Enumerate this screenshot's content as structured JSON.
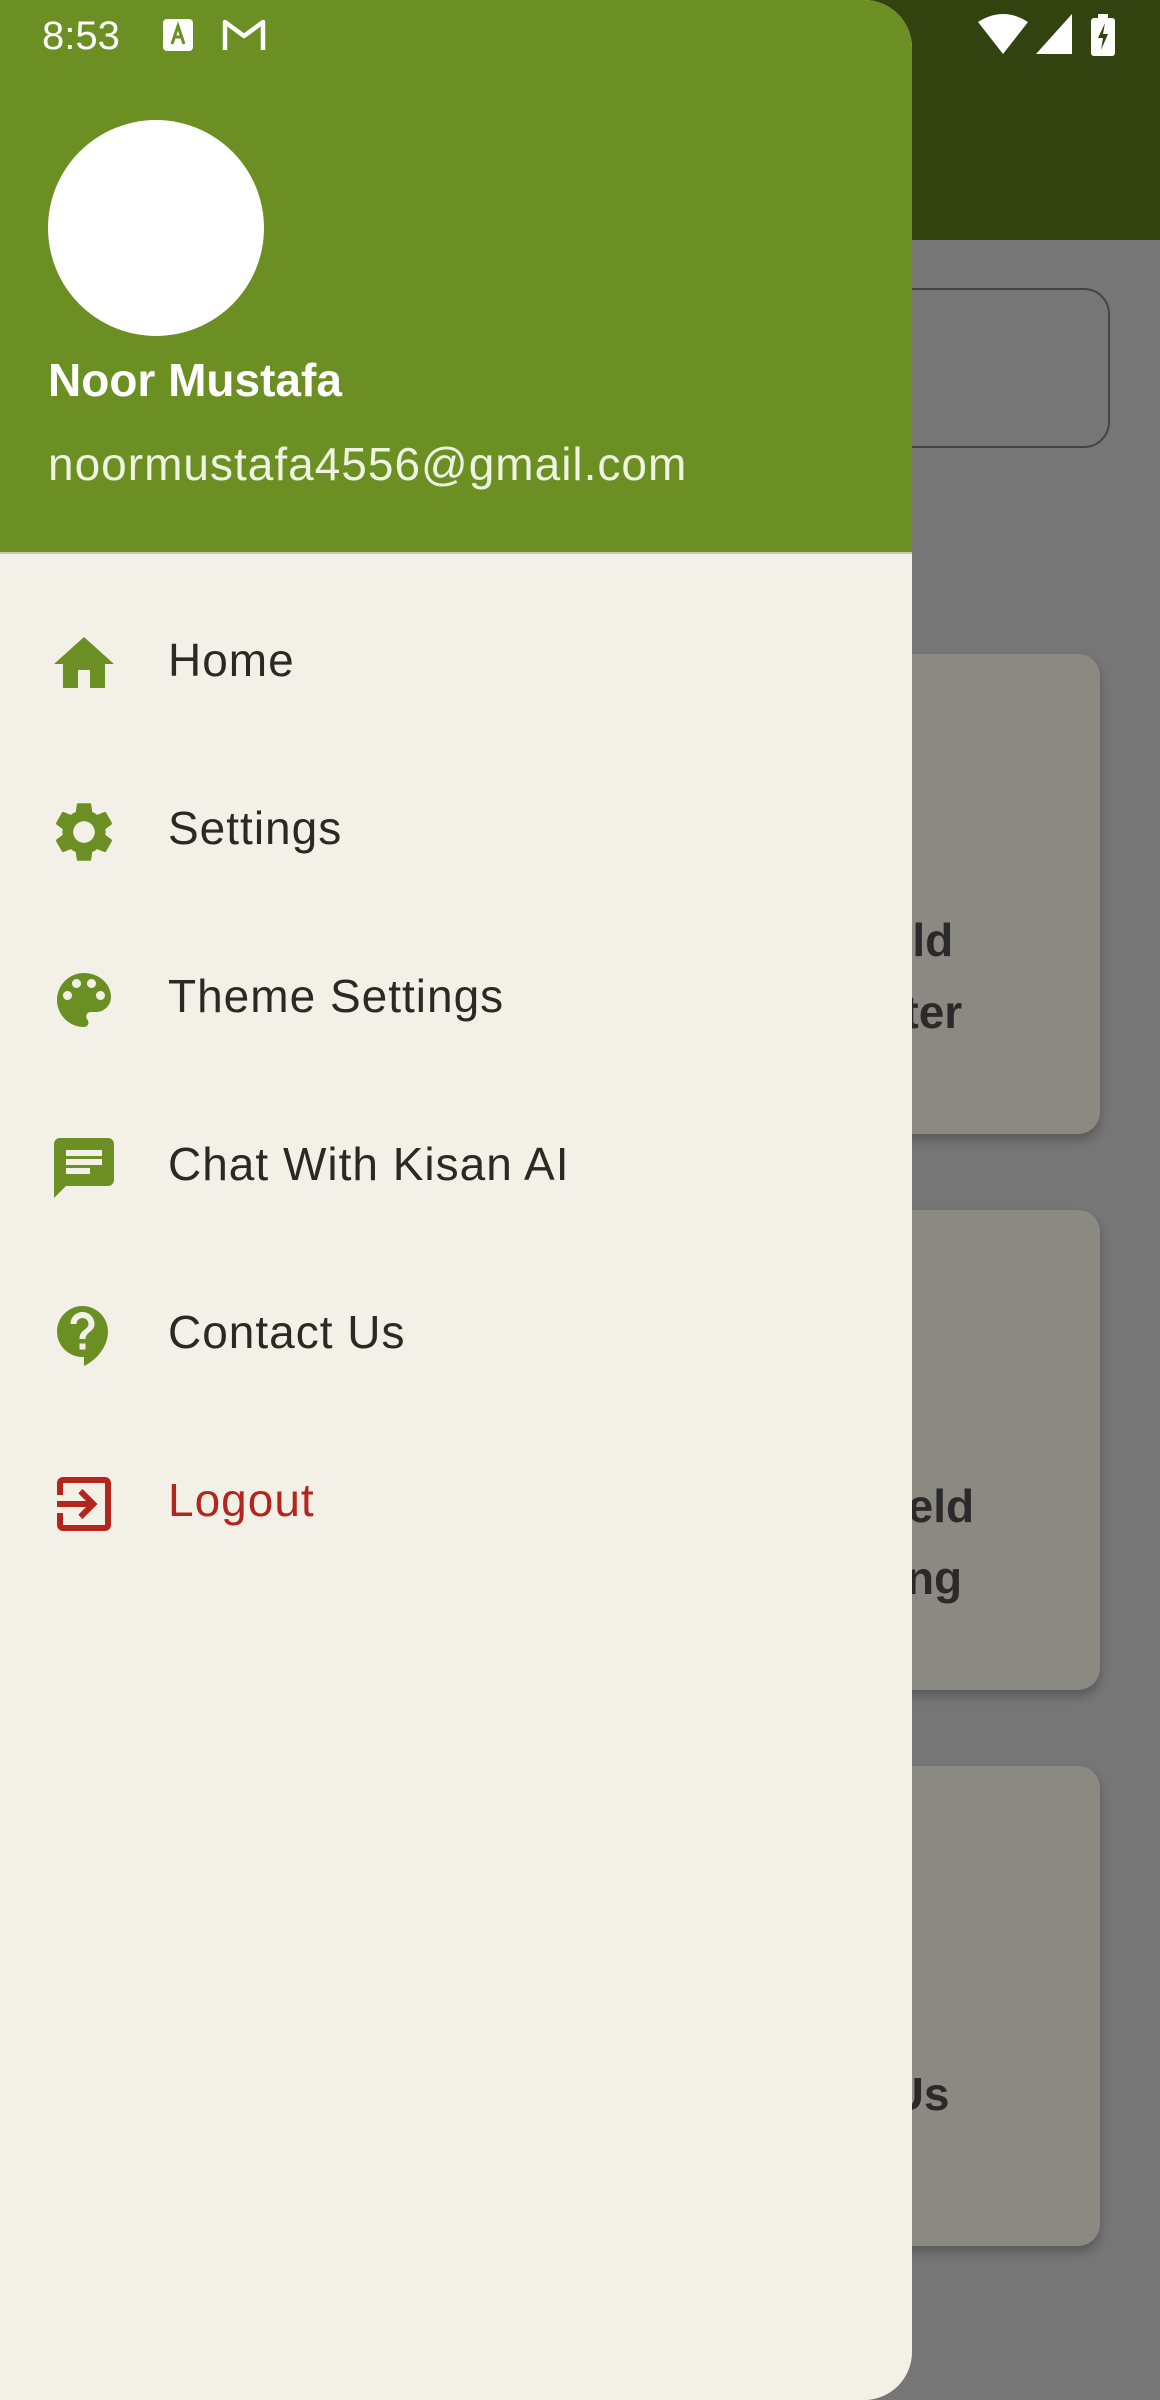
{
  "status_bar": {
    "time": "8:53",
    "left_icons": [
      "text-recognition-icon",
      "gmail-icon"
    ],
    "right_icons": [
      "wifi-icon",
      "signal-icon",
      "battery-charging-icon"
    ]
  },
  "drawer": {
    "header": {
      "user_name": "Noor Mustafa",
      "user_email": "noormustafa4556@gmail.com",
      "header_color": "#6b8f23"
    },
    "menu": [
      {
        "label": "Home",
        "icon": "home-icon"
      },
      {
        "label": "Settings",
        "icon": "gear-icon"
      },
      {
        "label": "Theme Settings",
        "icon": "palette-icon"
      },
      {
        "label": "Chat With Kisan AI",
        "icon": "chat-icon"
      },
      {
        "label": "Contact Us",
        "icon": "help-icon"
      },
      {
        "label": "Logout",
        "icon": "logout-icon"
      }
    ],
    "accent_color": "#6b8f23",
    "logout_color": "#b3261e"
  },
  "background": {
    "cards": [
      {
        "line1": "eld",
        "line2": "ster"
      },
      {
        "line1": "Yield",
        "line2": "ting"
      },
      {
        "line1": "Us",
        "line2": ""
      }
    ]
  }
}
